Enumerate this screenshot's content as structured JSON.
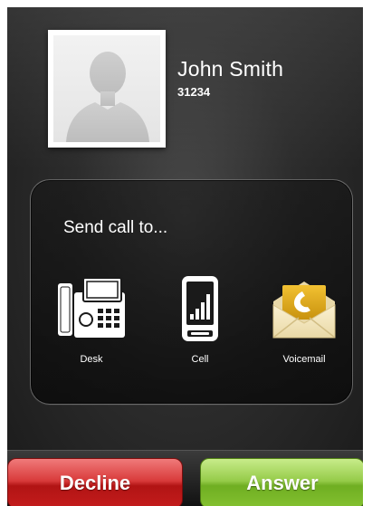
{
  "caller": {
    "name": "John Smith",
    "number": "31234"
  },
  "send_panel": {
    "title": "Send call to...",
    "destinations": [
      {
        "label": "Desk",
        "icon": "desk-phone-icon"
      },
      {
        "label": "Cell",
        "icon": "cell-phone-icon"
      },
      {
        "label": "Voicemail",
        "icon": "voicemail-icon"
      }
    ]
  },
  "actions": {
    "decline_label": "Decline",
    "answer_label": "Answer"
  },
  "colors": {
    "decline": "#c41c1c",
    "answer": "#84c130",
    "voicemail_envelope": "#d9aa1c"
  }
}
